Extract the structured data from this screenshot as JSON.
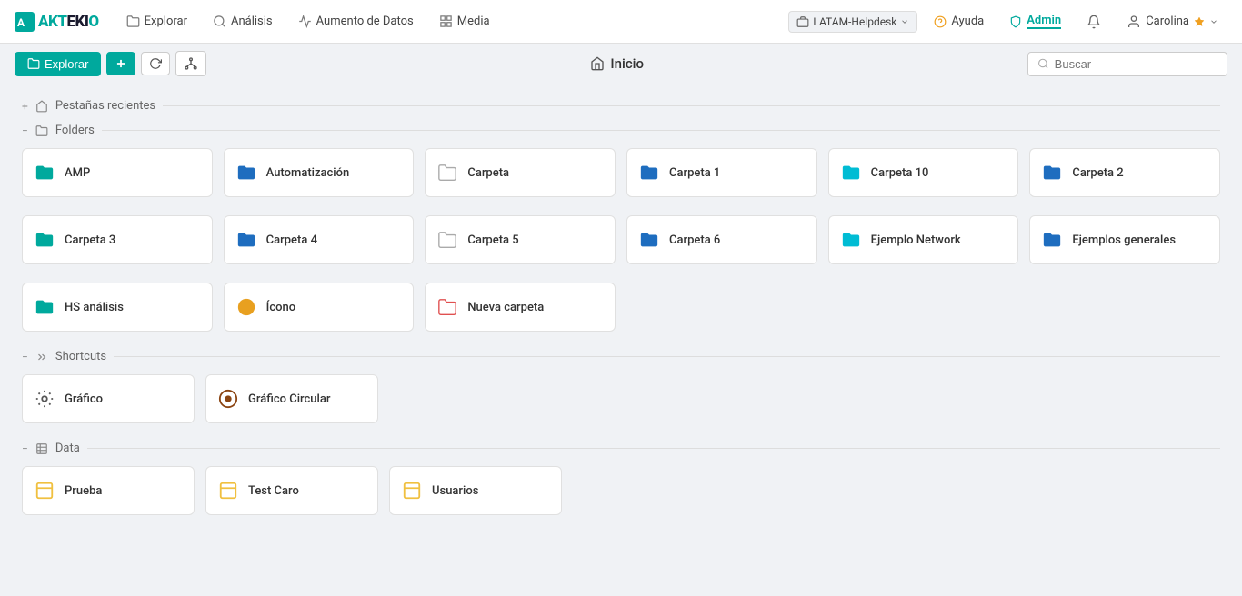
{
  "logo": {
    "text_ak": "AK",
    "text_tekio": "TEKIO",
    "full": "AKTEKIO"
  },
  "nav": {
    "items": [
      {
        "id": "explorar",
        "label": "Explorar",
        "icon": "folder-icon"
      },
      {
        "id": "analisis",
        "label": "Análisis",
        "icon": "search-icon"
      },
      {
        "id": "aumento-datos",
        "label": "Aumento de Datos",
        "icon": "chart-icon"
      },
      {
        "id": "media",
        "label": "Media",
        "icon": "grid-icon"
      }
    ],
    "right": {
      "latam": "LATAM-Helpdesk",
      "ayuda": "Ayuda",
      "admin": "Admin",
      "user": "Carolina"
    }
  },
  "explorar_bar": {
    "button_label": "Explorar",
    "home_label": "Inicio",
    "search_placeholder": "Buscar"
  },
  "sections": {
    "recent_tabs": {
      "label": "Pestañas recientes",
      "toggle": "+"
    },
    "folders": {
      "label": "Folders",
      "toggle": "−",
      "items": [
        {
          "id": "amp",
          "label": "AMP",
          "color": "teal",
          "icon_type": "folder-filled"
        },
        {
          "id": "automatizacion",
          "label": "Automatización",
          "color": "blue",
          "icon_type": "folder-filled"
        },
        {
          "id": "carpeta",
          "label": "Carpeta",
          "color": "empty",
          "icon_type": "folder-outline"
        },
        {
          "id": "carpeta1",
          "label": "Carpeta 1",
          "color": "blue",
          "icon_type": "folder-filled"
        },
        {
          "id": "carpeta10",
          "label": "Carpeta 10",
          "color": "cyan",
          "icon_type": "folder-filled"
        },
        {
          "id": "carpeta2",
          "label": "Carpeta 2",
          "color": "blue",
          "icon_type": "folder-filled"
        },
        {
          "id": "carpeta3",
          "label": "Carpeta 3",
          "color": "teal",
          "icon_type": "folder-filled"
        },
        {
          "id": "carpeta4",
          "label": "Carpeta 4",
          "color": "blue",
          "icon_type": "folder-filled"
        },
        {
          "id": "carpeta5",
          "label": "Carpeta 5",
          "color": "empty",
          "icon_type": "folder-outline"
        },
        {
          "id": "carpeta6",
          "label": "Carpeta 6",
          "color": "blue",
          "icon_type": "folder-filled"
        },
        {
          "id": "ejemplo-network",
          "label": "Ejemplo Network",
          "color": "cyan",
          "icon_type": "folder-filled"
        },
        {
          "id": "ejemplos-generales",
          "label": "Ejemplos generales",
          "color": "blue",
          "icon_type": "folder-filled"
        },
        {
          "id": "hs-analisis",
          "label": "HS análisis",
          "color": "teal",
          "icon_type": "folder-filled"
        },
        {
          "id": "icono",
          "label": "Ícono",
          "color": "orange",
          "icon_type": "circle-icon"
        },
        {
          "id": "nueva-carpeta",
          "label": "Nueva carpeta",
          "color": "red",
          "icon_type": "folder-outline"
        }
      ]
    },
    "shortcuts": {
      "label": "Shortcuts",
      "toggle": "−",
      "items": [
        {
          "id": "grafico",
          "label": "Gráfico",
          "color": "gear",
          "icon_type": "gear-icon"
        },
        {
          "id": "grafico-circular",
          "label": "Gráfico Circular",
          "color": "eye",
          "icon_type": "eye-icon"
        }
      ]
    },
    "data": {
      "label": "Data",
      "toggle": "−",
      "items": [
        {
          "id": "prueba",
          "label": "Prueba",
          "color": "yellow",
          "icon_type": "data-icon"
        },
        {
          "id": "test-caro",
          "label": "Test Caro",
          "color": "yellow",
          "icon_type": "data-icon"
        },
        {
          "id": "usuarios",
          "label": "Usuarios",
          "color": "yellow",
          "icon_type": "data-icon"
        }
      ]
    }
  }
}
